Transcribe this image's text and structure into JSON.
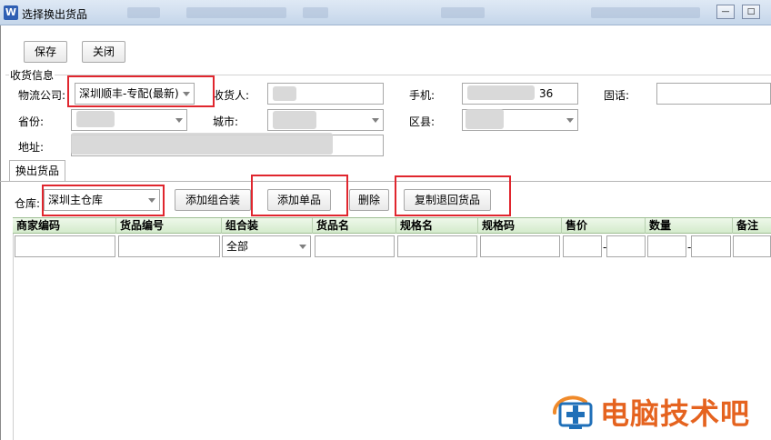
{
  "window": {
    "icon": "app-logo-icon",
    "title": "选择换出货品",
    "controls": [
      "minimize-icon",
      "maximize-icon"
    ]
  },
  "toolbar": {
    "save_label": "保存",
    "close_label": "关闭"
  },
  "receive_info": {
    "group_label": "收货信息",
    "logistics_label": "物流公司:",
    "logistics_value": "深圳顺丰-专配(最新)",
    "receiver_label": "收货人:",
    "receiver_value": "",
    "phone_label": "手机:",
    "phone_value": "36",
    "landline_label": "固话:",
    "landline_value": "",
    "province_label": "省份:",
    "city_label": "城市:",
    "district_label": "区县:",
    "address_label": "地址:"
  },
  "tabs": [
    {
      "label": "换出货品",
      "active": true
    }
  ],
  "product_bar": {
    "warehouse_label": "仓库:",
    "warehouse_value": "深圳主仓库",
    "add_combo_label": "添加组合装",
    "add_single_label": "添加单品",
    "delete_label": "删除",
    "copy_return_label": "复制退回货品"
  },
  "grid": {
    "columns": [
      "商家编码",
      "货品编号",
      "组合装",
      "货品名",
      "规格名",
      "规格码",
      "售价",
      "数量",
      "备注"
    ],
    "filter_combo_value": "全部",
    "range_separator": "-"
  },
  "watermark": {
    "icon": "computer-medic-icon",
    "text": "电脑技术吧"
  },
  "colors": {
    "highlight_red": "#e0262e",
    "grid_header_green": "#d4ebcc",
    "watermark_orange": "#e5631f"
  }
}
